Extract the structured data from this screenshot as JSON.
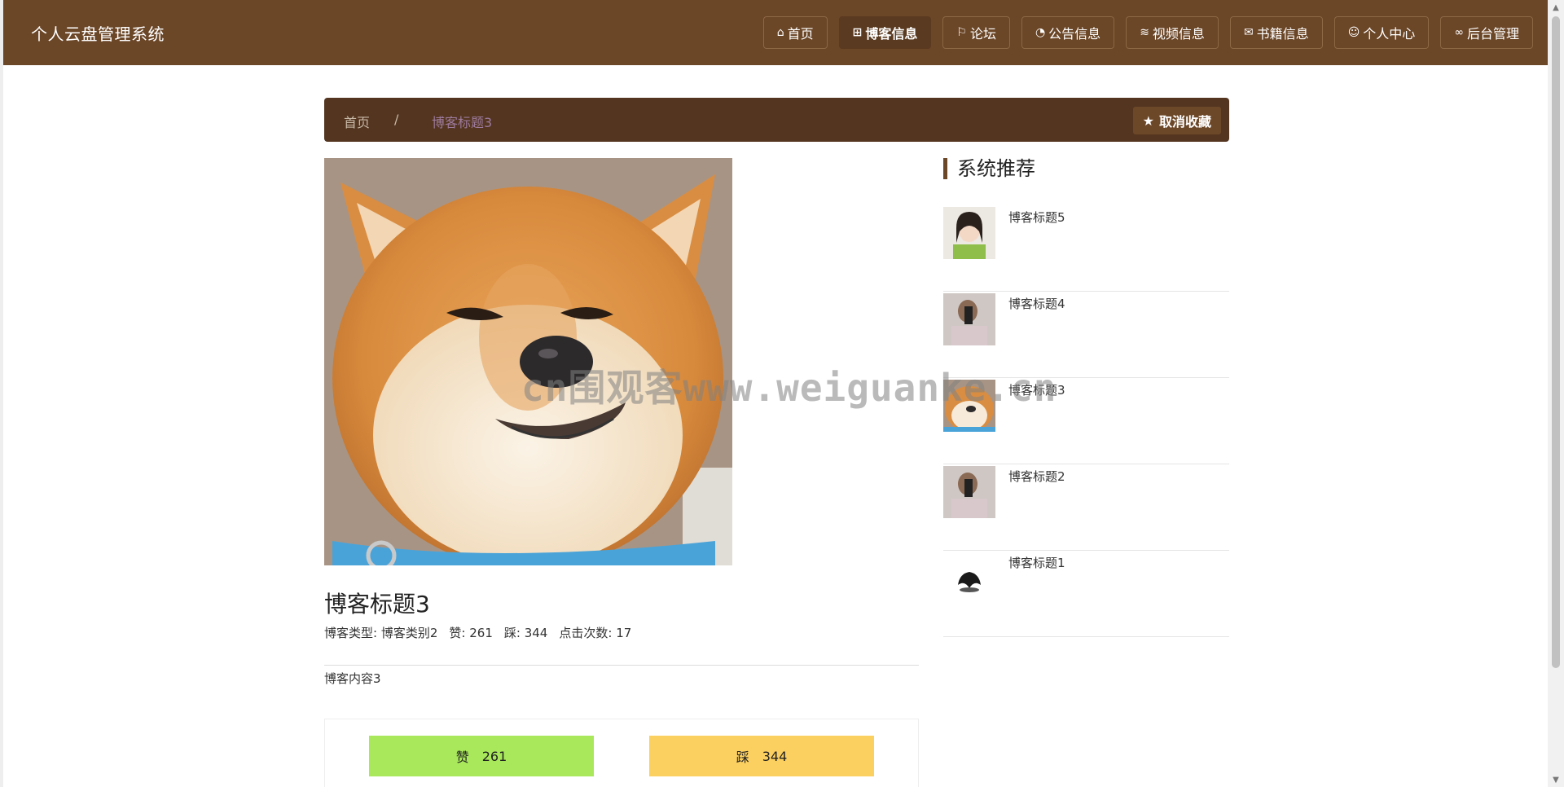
{
  "app": {
    "title": "个人云盘管理系统"
  },
  "nav": {
    "items": [
      {
        "label": "首页",
        "icon": "home-icon"
      },
      {
        "label": "博客信息",
        "icon": "gift-icon",
        "active": true
      },
      {
        "label": "论坛",
        "icon": "flag-icon"
      },
      {
        "label": "公告信息",
        "icon": "palette-icon"
      },
      {
        "label": "视频信息",
        "icon": "layers-icon"
      },
      {
        "label": "书籍信息",
        "icon": "mail-icon"
      },
      {
        "label": "个人中心",
        "icon": "user-icon"
      },
      {
        "label": "后台管理",
        "icon": "link-icon"
      }
    ]
  },
  "breadcrumb": {
    "home": "首页",
    "separator": "/",
    "current": "博客标题3"
  },
  "favorite": {
    "label": "取消收藏",
    "icon": "star-icon"
  },
  "post": {
    "title": "博客标题3",
    "type_label": "博客类型:",
    "type_value": "博客类别2",
    "like_label": "赞:",
    "like_value": "261",
    "dislike_label": "踩:",
    "dislike_value": "344",
    "views_label": "点击次数:",
    "views_value": "17",
    "content": "博客内容3"
  },
  "votes": {
    "like_label": "赞",
    "like_count": "261",
    "dislike_label": "踩",
    "dislike_count": "344"
  },
  "sidebar": {
    "title": "系统推荐",
    "items": [
      {
        "title": "博客标题5"
      },
      {
        "title": "博客标题4"
      },
      {
        "title": "博客标题3"
      },
      {
        "title": "博客标题2"
      },
      {
        "title": "博客标题1"
      }
    ]
  },
  "watermark": {
    "text": "cn围观客www.weiguanke.cn"
  },
  "colors": {
    "topbar": "#6b4627",
    "breadcrumb": "#533520",
    "like": "#a8e85a",
    "dislike": "#fcd060"
  }
}
